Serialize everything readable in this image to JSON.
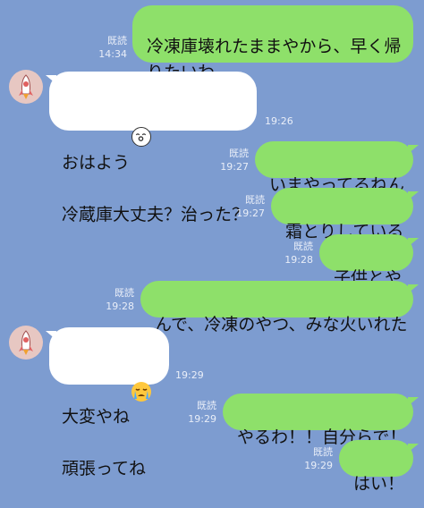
{
  "messages": [
    {
      "side": "sent",
      "text": "冷凍庫壊れたままやから、早く帰\nりたいわ、、。",
      "read": "既読",
      "time": "14:34"
    },
    {
      "side": "recv",
      "text_line1": "おはよう",
      "emoji1": "sleepy-face-icon",
      "text_line2": "冷蔵庫大丈夫？治った？",
      "time": "19:26"
    },
    {
      "side": "sent",
      "text": "いまやってるねん",
      "read": "既読",
      "time": "19:27"
    },
    {
      "side": "sent",
      "text": "霜とりしている",
      "read": "既読",
      "time": "19:27"
    },
    {
      "side": "sent",
      "text": "子供とや",
      "read": "既読",
      "time": "19:28"
    },
    {
      "side": "sent",
      "text": "んで、冷凍のやつ、みな火いれた",
      "read": "既読",
      "time": "19:28"
    },
    {
      "side": "recv",
      "text_line1": "大変やね",
      "emoji1": "crying-face-icon",
      "text_line2": "頑張ってね",
      "time": "19:29"
    },
    {
      "side": "sent",
      "text": "やるわ！！自分らで！",
      "read": "既読",
      "time": "19:29"
    },
    {
      "side": "sent",
      "text": "はい！",
      "read": "既読",
      "time": "19:29"
    }
  ],
  "colors": {
    "background": "#7d9cd0",
    "sent_bubble": "#8ee06a",
    "received_bubble": "#ffffff"
  }
}
